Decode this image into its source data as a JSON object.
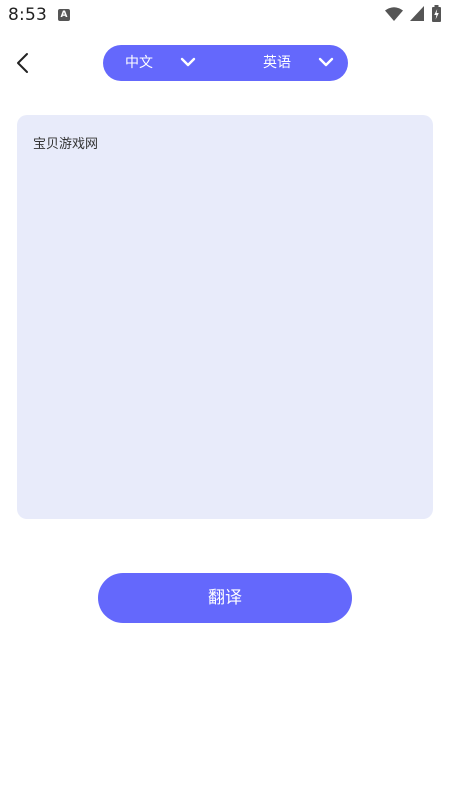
{
  "status_bar": {
    "time": "8:53",
    "app_icon_letter": "A",
    "icons": [
      "wifi-icon",
      "cellular-signal-icon",
      "battery-charging-icon"
    ]
  },
  "header": {
    "back_icon": "chevron-left-icon",
    "source_language": "中文",
    "target_language": "英语",
    "dropdown_icon": "chevron-down-icon"
  },
  "input": {
    "text": "宝贝游戏网"
  },
  "actions": {
    "translate_label": "翻译"
  },
  "colors": {
    "accent": "#6468fc",
    "input_background": "#e8ebfa",
    "page_background": "#ffffff"
  }
}
